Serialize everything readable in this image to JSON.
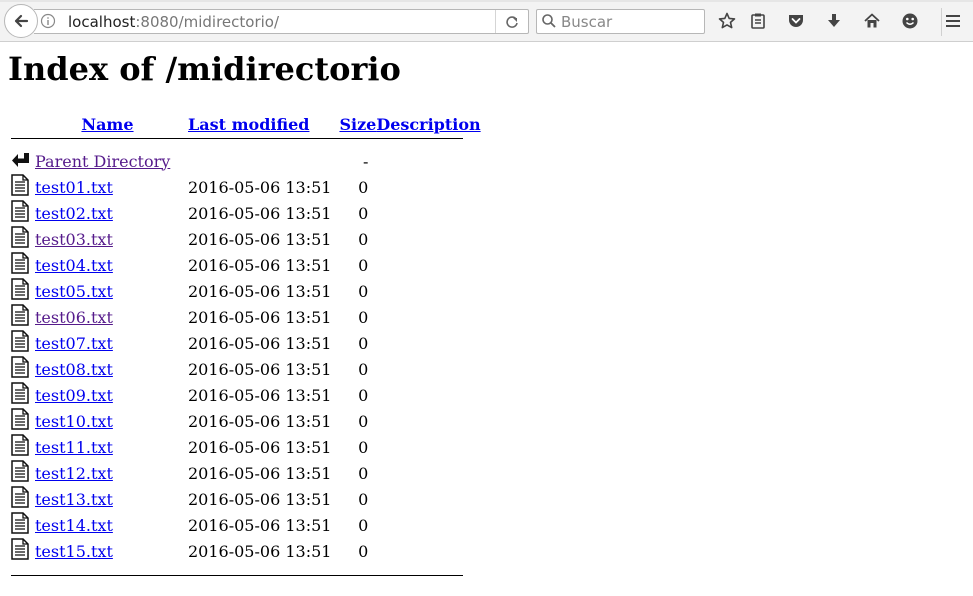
{
  "browser": {
    "url_host": "localhost",
    "url_path": ":8080/midirectorio/",
    "search_placeholder": "Buscar"
  },
  "page": {
    "title": "Index of /midirectorio"
  },
  "table": {
    "headers": {
      "name": "Name",
      "modified": "Last modified",
      "size": "Size",
      "description": "Description"
    },
    "parent": {
      "name": "Parent Directory",
      "size": "-"
    },
    "rows": [
      {
        "name": "test01.txt",
        "modified": "2016-05-06 13:51",
        "size": "0"
      },
      {
        "name": "test02.txt",
        "modified": "2016-05-06 13:51",
        "size": "0"
      },
      {
        "name": "test03.txt",
        "modified": "2016-05-06 13:51",
        "size": "0"
      },
      {
        "name": "test04.txt",
        "modified": "2016-05-06 13:51",
        "size": "0"
      },
      {
        "name": "test05.txt",
        "modified": "2016-05-06 13:51",
        "size": "0"
      },
      {
        "name": "test06.txt",
        "modified": "2016-05-06 13:51",
        "size": "0"
      },
      {
        "name": "test07.txt",
        "modified": "2016-05-06 13:51",
        "size": "0"
      },
      {
        "name": "test08.txt",
        "modified": "2016-05-06 13:51",
        "size": "0"
      },
      {
        "name": "test09.txt",
        "modified": "2016-05-06 13:51",
        "size": "0"
      },
      {
        "name": "test10.txt",
        "modified": "2016-05-06 13:51",
        "size": "0"
      },
      {
        "name": "test11.txt",
        "modified": "2016-05-06 13:51",
        "size": "0"
      },
      {
        "name": "test12.txt",
        "modified": "2016-05-06 13:51",
        "size": "0"
      },
      {
        "name": "test13.txt",
        "modified": "2016-05-06 13:51",
        "size": "0"
      },
      {
        "name": "test14.txt",
        "modified": "2016-05-06 13:51",
        "size": "0"
      },
      {
        "name": "test15.txt",
        "modified": "2016-05-06 13:51",
        "size": "0"
      }
    ]
  }
}
